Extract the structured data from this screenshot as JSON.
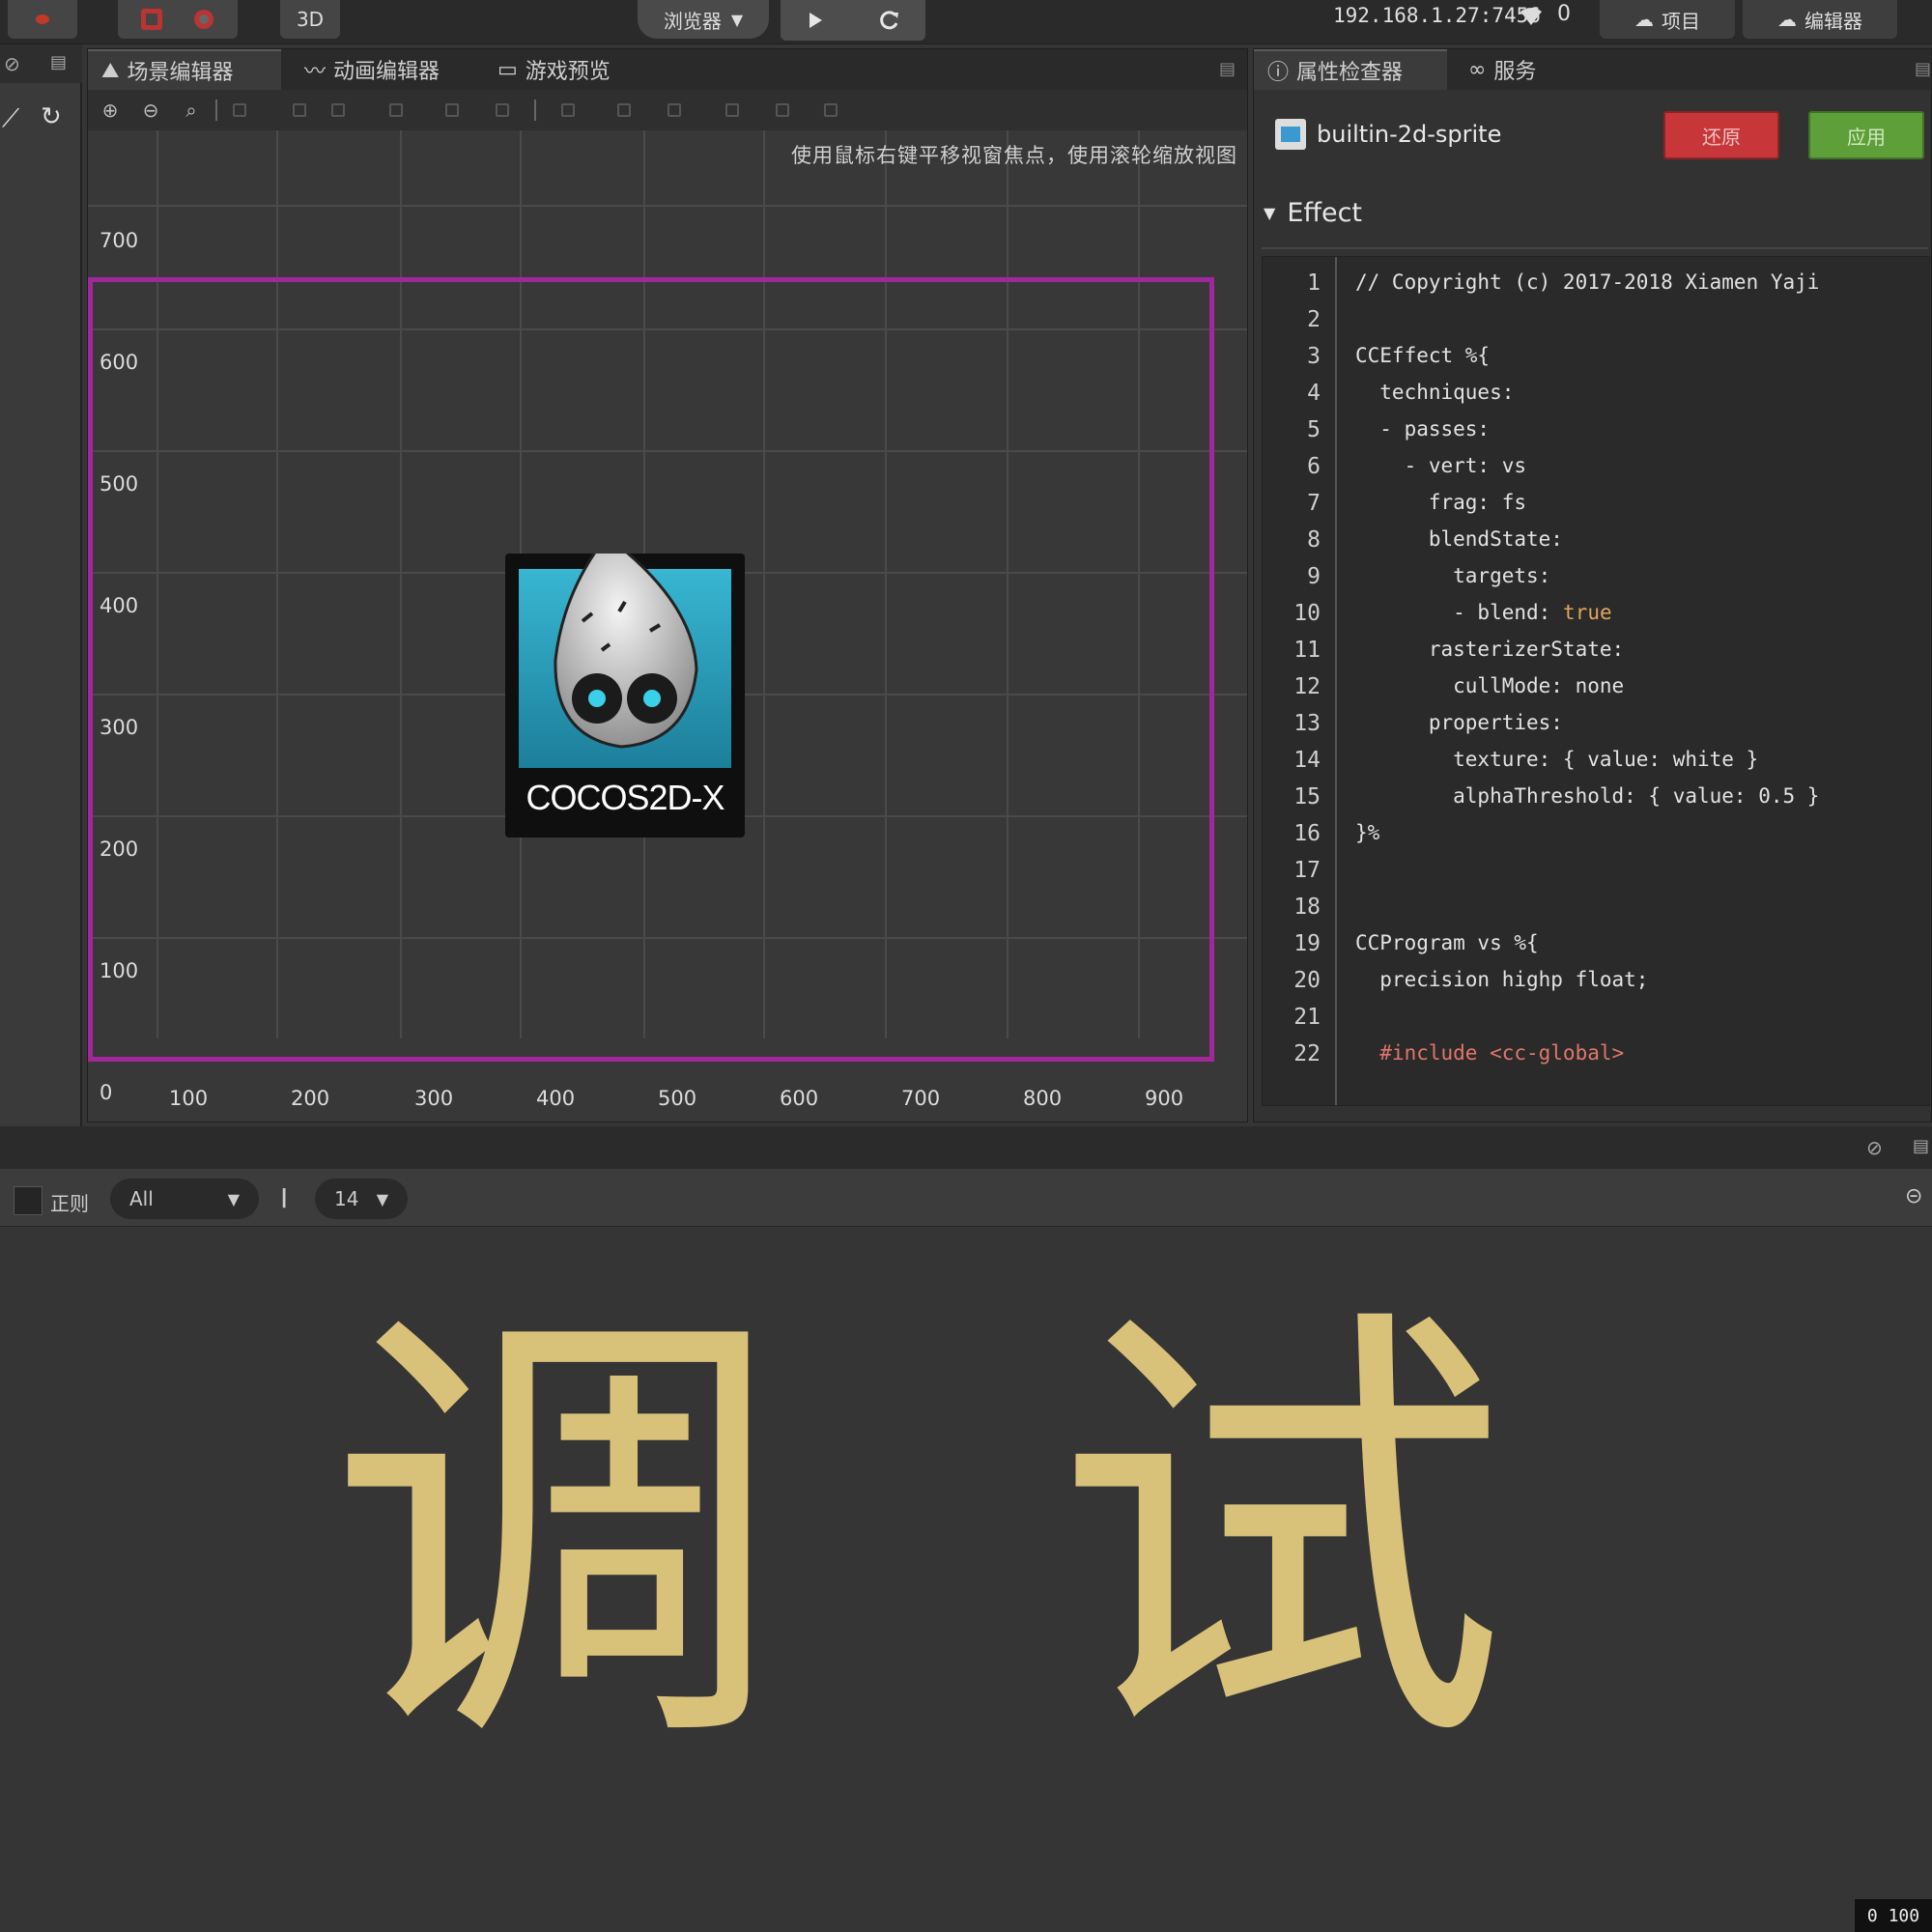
{
  "toolbar": {
    "mode_3d": "3D",
    "platform_select": "浏览器",
    "ip_address": "192.168.1.27:7456",
    "connected_count": "0",
    "open_project": "项目",
    "open_editor": "编辑器"
  },
  "scene_panel": {
    "tabs": [
      {
        "label": "场景编辑器",
        "icon": "scene-icon"
      },
      {
        "label": "动画编辑器",
        "icon": "animation-icon"
      },
      {
        "label": "游戏预览",
        "icon": "game-icon"
      }
    ],
    "hint": "使用鼠标右键平移视窗焦点，使用滚轮缩放视图",
    "y_ticks": [
      "700",
      "600",
      "500",
      "400",
      "300",
      "200",
      "100",
      "0"
    ],
    "x_ticks": [
      "100",
      "200",
      "300",
      "400",
      "500",
      "600",
      "700",
      "800",
      "900"
    ],
    "sprite_logo_text": "COCOS2D-X",
    "canvas_border_color": "#a0289a"
  },
  "inspector": {
    "tabs": [
      {
        "label": "属性检查器",
        "icon": "inspector-icon"
      },
      {
        "label": "服务",
        "icon": "service-icon"
      }
    ],
    "asset_name": "builtin-2d-sprite",
    "revert_label": "还原",
    "apply_label": "应用",
    "section_title": "Effect",
    "code_lines": [
      {
        "n": "1",
        "text": "// Copyright (c) 2017-2018 Xiamen Yaji"
      },
      {
        "n": "2",
        "text": ""
      },
      {
        "n": "3",
        "text": "CCEffect %{"
      },
      {
        "n": "4",
        "text": "  techniques:"
      },
      {
        "n": "5",
        "text": "  - passes:"
      },
      {
        "n": "6",
        "text": "    - vert: vs"
      },
      {
        "n": "7",
        "text": "      frag: fs"
      },
      {
        "n": "8",
        "text": "      blendState:"
      },
      {
        "n": "9",
        "text": "        targets:"
      },
      {
        "n": "10",
        "text": "        - blend: ",
        "kw": "true"
      },
      {
        "n": "11",
        "text": "      rasterizerState:"
      },
      {
        "n": "12",
        "text": "        cullMode: none"
      },
      {
        "n": "13",
        "text": "      properties:"
      },
      {
        "n": "14",
        "text": "        texture: { value: white }"
      },
      {
        "n": "15",
        "text": "        alphaThreshold: { value: 0.5 }"
      },
      {
        "n": "16",
        "text": "}%"
      },
      {
        "n": "17",
        "text": ""
      },
      {
        "n": "18",
        "text": ""
      },
      {
        "n": "19",
        "text": "CCProgram vs %{"
      },
      {
        "n": "20",
        "text": "  precision highp float;"
      },
      {
        "n": "21",
        "text": ""
      },
      {
        "n": "22",
        "text": "  #include <cc-global>"
      }
    ]
  },
  "console": {
    "regex_label": "正则",
    "log_level": "All",
    "font_size": "14",
    "big_title_char1": "调",
    "big_title_char2": "试",
    "corner_badge": "0 100"
  },
  "colors": {
    "accent_gold": "#d8c27a",
    "revert_red": "#c7373a",
    "apply_green": "#5f9f3a"
  }
}
